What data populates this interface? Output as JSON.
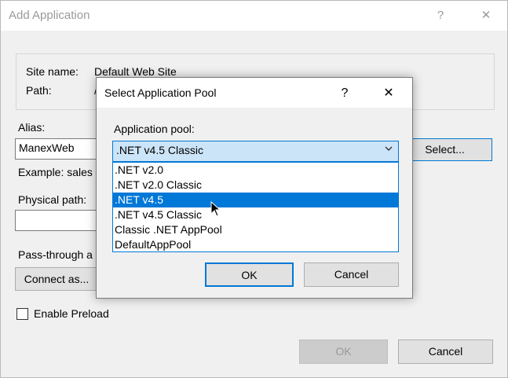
{
  "window": {
    "title": "Add Application",
    "help_glyph": "?",
    "close_glyph": "✕"
  },
  "site": {
    "site_name_label": "Site name:",
    "site_name_value": "Default Web Site",
    "path_label": "Path:",
    "path_value": "/"
  },
  "alias": {
    "label": "Alias:",
    "value": "ManexWeb",
    "example": "Example: sales"
  },
  "physical_path": {
    "label": "Physical path:",
    "value": ""
  },
  "pass_through": {
    "label": "Pass-through a",
    "connect_button": "Connect as..."
  },
  "select_button": "Select...",
  "enable_preload": {
    "label": "Enable Preload",
    "checked": false
  },
  "footer": {
    "ok_label": "OK",
    "cancel_label": "Cancel"
  },
  "dialog": {
    "title": "Select Application Pool",
    "help_glyph": "?",
    "close_glyph": "✕",
    "pool_label": "Application pool:",
    "selected_value": ".NET v4.5 Classic",
    "options": [
      ".NET v2.0",
      ".NET v2.0 Classic",
      ".NET v4.5",
      ".NET v4.5 Classic",
      "Classic .NET AppPool",
      "DefaultAppPool"
    ],
    "highlighted_index": 2,
    "ok_label": "OK",
    "cancel_label": "Cancel"
  },
  "colors": {
    "accent": "#0078d7",
    "combo_bg": "#cce4f7"
  }
}
